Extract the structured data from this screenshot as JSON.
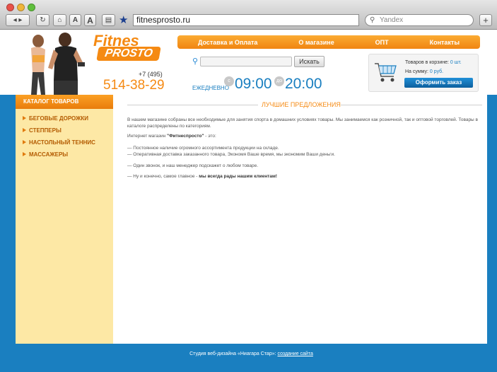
{
  "browser": {
    "url": "fitnesprosto.ru",
    "search_placeholder": "Yandex"
  },
  "header": {
    "logo_line1": "Fitnes",
    "logo_line2": "PROSTO",
    "phone_code": "+7 (495)",
    "phone_number": "514-38-29",
    "menu": [
      {
        "label": "Доставка и Оплата"
      },
      {
        "label": "О магазине"
      },
      {
        "label": "ОПТ"
      },
      {
        "label": "Контакты"
      }
    ],
    "search_button": "Искать",
    "hours_label": "ЕЖЕДНЕВНО",
    "hours_from_badge": "с",
    "hours_from": "09:00",
    "hours_to_badge": "до",
    "hours_to": "20:00",
    "cart": {
      "items_label": "Товаров в корзине:",
      "items_value": "0 шт.",
      "sum_label": "На сумму:",
      "sum_value": "0 руб.",
      "order_button": "Оформить заказ"
    }
  },
  "sidebar": {
    "title": "КАТАЛОГ ТОВАРОВ",
    "items": [
      {
        "label": "БЕГОВЫЕ ДОРОЖКИ"
      },
      {
        "label": "СТЕППЕРЫ"
      },
      {
        "label": "НАСТОЛЬНЫЙ ТЕННИС"
      },
      {
        "label": "МАССАЖЕРЫ"
      }
    ]
  },
  "content": {
    "section_title": "ЛУЧШИЕ ПРЕДЛОЖЕНИЯ",
    "p1": "В нашем магазине собраны все необходимые для занятия спорта в домашних условиях товары. Мы занимаемся как розничной, так и оптовой торговлей. Товары в каталоге распределены по категориям.",
    "p2_prefix": "Интернет магазин ",
    "p2_brand": "\"Фитнеспросто\"",
    "p2_suffix": " - это:",
    "bullet1": "— Постоянное наличие огромного ассортимента продукции на складе.",
    "bullet2": "— Оперативная доставка заказанного товара, Экономя Ваше время, мы экономим Ваши деньги.",
    "p3": "— Один звонок, и наш менеджер подскажет о любом товаре.",
    "p4_prefix": "— Ну и конечно, самое главное - ",
    "p4_bold": "мы всегда рады нашим клиентам!"
  },
  "footer": {
    "text": "Студия веб-дизайна «Ниагара Стар»: ",
    "link": "создание сайта"
  },
  "colors": {
    "brand_orange": "#f58a13",
    "brand_blue": "#1a7fc0",
    "sidebar_bg": "#fde8a5"
  }
}
